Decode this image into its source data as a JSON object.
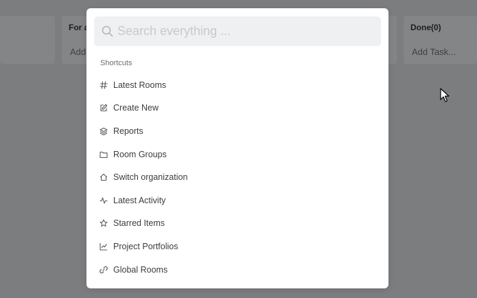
{
  "board": {
    "columns": [
      {
        "title": "",
        "add_label": ""
      },
      {
        "title": "For a",
        "add_label": "Add"
      },
      {
        "title": "",
        "add_label": ""
      },
      {
        "title": "Done(0)",
        "add_label": "Add Task..."
      }
    ]
  },
  "search": {
    "placeholder": "Search everything ...",
    "icon": "search-icon"
  },
  "shortcuts": {
    "label": "Shortcuts",
    "items": [
      {
        "label": "Latest Rooms",
        "icon": "hash-icon"
      },
      {
        "label": "Create New",
        "icon": "edit-icon"
      },
      {
        "label": "Reports",
        "icon": "layers-icon"
      },
      {
        "label": "Room Groups",
        "icon": "folder-icon"
      },
      {
        "label": "Switch organization",
        "icon": "home-icon"
      },
      {
        "label": "Latest Activity",
        "icon": "activity-icon"
      },
      {
        "label": "Starred Items",
        "icon": "star-icon"
      },
      {
        "label": "Project Portfolios",
        "icon": "chart-icon"
      },
      {
        "label": "Global Rooms",
        "icon": "link-icon"
      }
    ]
  },
  "colors": {
    "overlay": "#7d7e80",
    "modal_bg": "#ffffff",
    "search_bg": "#eef0f1",
    "text": "#3a3c3f"
  }
}
